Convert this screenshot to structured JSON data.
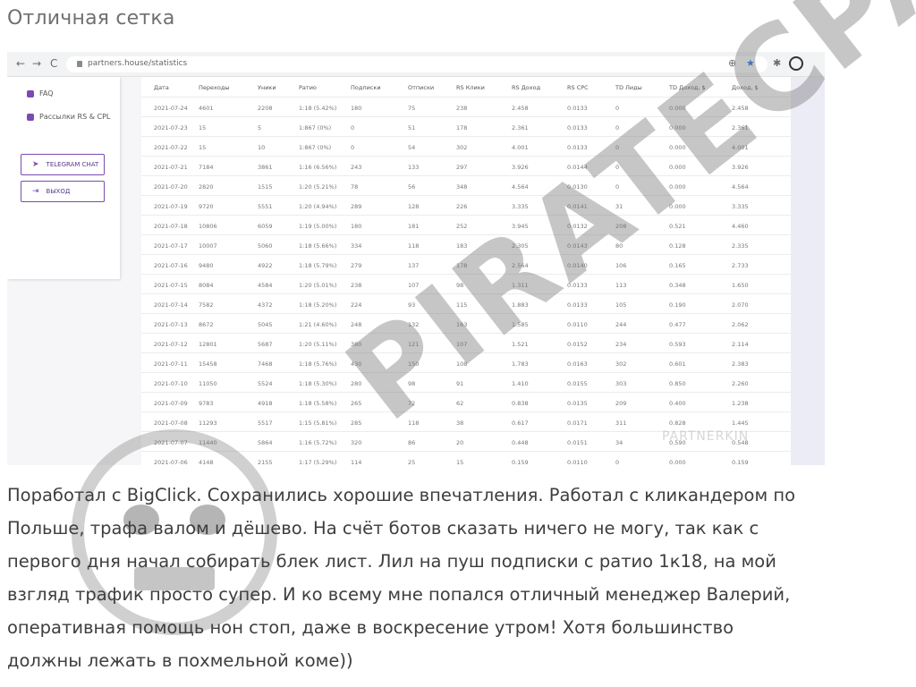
{
  "heading": "Отличная сетка",
  "browser": {
    "back": "←",
    "forward": "→",
    "reload": "C",
    "url": "partners.house/statistics",
    "zoom_icon": "⊕",
    "star_icon": "★",
    "ext_icon": "✱",
    "menu_icon": "⋮"
  },
  "sidebar": {
    "faq": "FAQ",
    "offers": "Рассылки RS & CPL",
    "telegram": "TELEGRAM CHAT",
    "logout": "ВЫХОД"
  },
  "table": {
    "headers": [
      "Дата",
      "Переходы",
      "Уники",
      "Ратио",
      "Подписки",
      "Отписки",
      "RS Клики",
      "RS Доход",
      "RS CPC",
      "TD Лиды",
      "TD Доход, $",
      "Доход, $"
    ],
    "rows": [
      [
        "2021-07-24",
        "4601",
        "2208",
        "1:18 (5.42%)",
        "180",
        "75",
        "238",
        "2.458",
        "0.0133",
        "0",
        "0.000",
        "2.458"
      ],
      [
        "2021-07-23",
        "15",
        "5",
        "1:867 (0%)",
        "0",
        "51",
        "178",
        "2.361",
        "0.0133",
        "0",
        "0.000",
        "2.361"
      ],
      [
        "2021-07-22",
        "15",
        "10",
        "1:867 (0%)",
        "0",
        "54",
        "302",
        "4.001",
        "0.0133",
        "0",
        "0.000",
        "4.001"
      ],
      [
        "2021-07-21",
        "7184",
        "3861",
        "1:16 (6.56%)",
        "243",
        "133",
        "297",
        "3.926",
        "0.0144",
        "0",
        "0.000",
        "3.926"
      ],
      [
        "2021-07-20",
        "2820",
        "1515",
        "1:20 (5.21%)",
        "78",
        "56",
        "348",
        "4.564",
        "0.0130",
        "0",
        "0.000",
        "4.564"
      ],
      [
        "2021-07-19",
        "9720",
        "5551",
        "1:20 (4.94%)",
        "289",
        "128",
        "226",
        "3.335",
        "0.0141",
        "31",
        "0.000",
        "3.335"
      ],
      [
        "2021-07-18",
        "10806",
        "6059",
        "1:19 (5.00%)",
        "180",
        "181",
        "252",
        "3.945",
        "0.0132",
        "208",
        "0.521",
        "4.460"
      ],
      [
        "2021-07-17",
        "10007",
        "5060",
        "1:18 (5.66%)",
        "334",
        "118",
        "183",
        "2.305",
        "0.0143",
        "80",
        "0.128",
        "2.335"
      ],
      [
        "2021-07-16",
        "9480",
        "4922",
        "1:18 (5.79%)",
        "279",
        "137",
        "178",
        "2.564",
        "0.0140",
        "106",
        "0.165",
        "2.733"
      ],
      [
        "2021-07-15",
        "8084",
        "4584",
        "1:20 (5.01%)",
        "238",
        "107",
        "98",
        "1.311",
        "0.0133",
        "113",
        "0.348",
        "1.650"
      ],
      [
        "2021-07-14",
        "7582",
        "4372",
        "1:18 (5.20%)",
        "224",
        "93",
        "115",
        "1.883",
        "0.0133",
        "105",
        "0.190",
        "2.070"
      ],
      [
        "2021-07-13",
        "8672",
        "5045",
        "1:21 (4.60%)",
        "248",
        "132",
        "163",
        "1.585",
        "0.0110",
        "244",
        "0.477",
        "2.062"
      ],
      [
        "2021-07-12",
        "12801",
        "5687",
        "1:20 (5.11%)",
        "380",
        "121",
        "107",
        "1.521",
        "0.0152",
        "234",
        "0.593",
        "2.114"
      ],
      [
        "2021-07-11",
        "15458",
        "7468",
        "1:18 (5.76%)",
        "430",
        "150",
        "108",
        "1.783",
        "0.0163",
        "302",
        "0.601",
        "2.383"
      ],
      [
        "2021-07-10",
        "11050",
        "5524",
        "1:18 (5.30%)",
        "280",
        "98",
        "91",
        "1.410",
        "0.0155",
        "303",
        "0.850",
        "2.260"
      ],
      [
        "2021-07-09",
        "9783",
        "4918",
        "1:18 (5.58%)",
        "265",
        "72",
        "62",
        "0.838",
        "0.0135",
        "209",
        "0.400",
        "1.238"
      ],
      [
        "2021-07-08",
        "11293",
        "5517",
        "1:15 (5.81%)",
        "285",
        "118",
        "38",
        "0.617",
        "0.0171",
        "311",
        "0.828",
        "1.445"
      ],
      [
        "2021-07-07",
        "11440",
        "5864",
        "1:16 (5.72%)",
        "320",
        "86",
        "20",
        "0.448",
        "0.0151",
        "34",
        "0.590",
        "0.548"
      ],
      [
        "2021-07-06",
        "4148",
        "2155",
        "1:17 (5.29%)",
        "114",
        "25",
        "15",
        "0.159",
        "0.0110",
        "0",
        "0.000",
        "0.159"
      ]
    ]
  },
  "watermark": {
    "text": "PIRATECPA",
    "small": "PARTNERKIN"
  },
  "body": [
    "Поработал с BigClick. Сохранились хорошие впечатления. Работал с кликандером по",
    "Польше, трафа валом и дёшево. На счёт ботов сказать ничего не могу, так как с",
    "первого дня начал собирать блек лист. Лил на пуш подписки с ратио 1к18, на мой",
    "взгляд трафик просто супер. И ко всему мне попался отличный менеджер Валерий,",
    "оперативная помощь нон стоп, даже в воскресение утром! Хотя большинство",
    "должны лежать в похмельной коме))"
  ]
}
